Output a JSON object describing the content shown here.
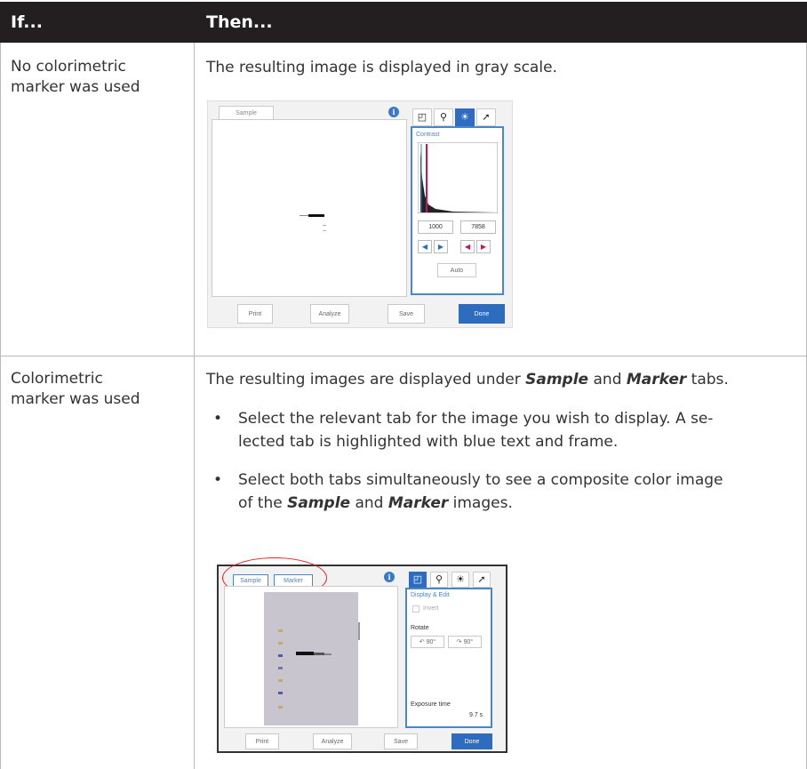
{
  "table": {
    "header": {
      "if": "If...",
      "then": "Then..."
    },
    "row1": {
      "if": [
        "No colorimetric",
        "marker was used"
      ],
      "then": "The resulting image is displayed in gray scale."
    },
    "row2": {
      "if": [
        "Colorimetric",
        "marker was used"
      ],
      "then_prefix": "The resulting images are displayed under ",
      "then_b1": "Sample",
      "then_mid": " and ",
      "then_b2": "Marker",
      "then_suffix": " tabs.",
      "bullet1_line1": "Select the relevant tab for the image you wish to display. A se-",
      "bullet1_line2": "lected tab is highlighted with blue text and frame.",
      "bullet2_line1": "Select both tabs simultaneously to see a composite color image",
      "bullet2_pre": "of the ",
      "bullet2_b1": "Sample",
      "bullet2_mid": " and ",
      "bullet2_b2": "Marker",
      "bullet2_post": " images."
    }
  },
  "screenshot1": {
    "tab_sample": "Sample",
    "info": "i",
    "panel_title": "Contrast",
    "min_value": "1000",
    "max_value": "7858",
    "auto": "Auto",
    "buttons": {
      "print": "Print",
      "analyze": "Analyze",
      "save": "Save",
      "done": "Done"
    },
    "marker_color": "#c2185b"
  },
  "screenshot2": {
    "tab_sample": "Sample",
    "tab_marker": "Marker",
    "info": "i",
    "panel_title": "Display & Edit",
    "invert": "Invert",
    "rotate": "Rotate",
    "rotate_left": "90°",
    "rotate_right": "90°",
    "exposure_label": "Exposure time",
    "exposure_value": "9.7 s",
    "buttons": {
      "print": "Print",
      "analyze": "Analyze",
      "save": "Save",
      "done": "Done"
    },
    "highlight_color": "#e02020"
  }
}
